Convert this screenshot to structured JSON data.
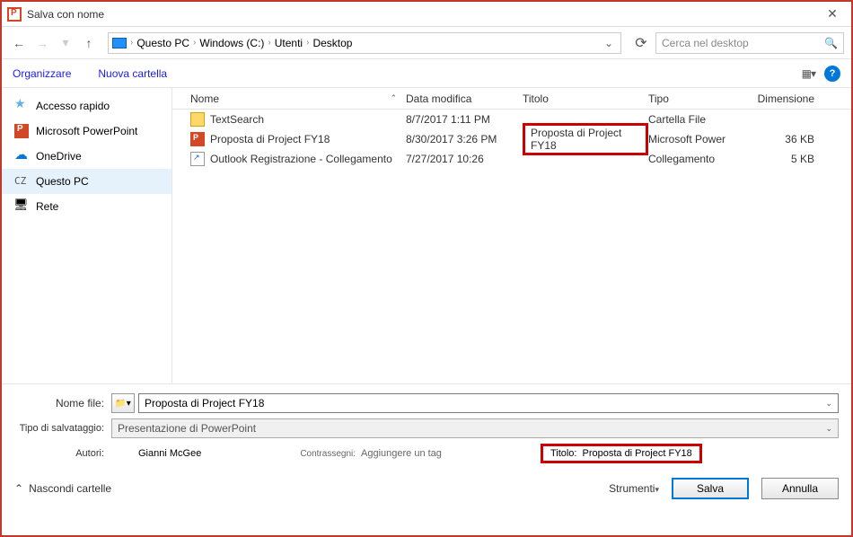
{
  "titlebar": {
    "title": "Salva con nome"
  },
  "breadcrumb": {
    "parts": [
      "Questo PC",
      "Windows (C:)",
      "Utenti",
      "Desktop"
    ]
  },
  "search": {
    "placeholder": "Cerca nel desktop"
  },
  "toolbar": {
    "organize": "Organizzare",
    "new_folder": "Nuova cartella"
  },
  "columns": {
    "name": "Nome",
    "date": "Data modifica",
    "title": "Titolo",
    "type": "Tipo",
    "size": "Dimensione"
  },
  "sidebar": {
    "items": [
      {
        "label": "Accesso rapido"
      },
      {
        "label": "Microsoft PowerPoint"
      },
      {
        "label": "OneDrive"
      },
      {
        "label": "Questo PC",
        "prefix": "CZ"
      },
      {
        "label": "Rete"
      }
    ]
  },
  "files": [
    {
      "name": "TextSearch",
      "date": "8/7/2017 1:11 PM",
      "title": "",
      "type": "Cartella File",
      "size": "",
      "icon": "folder"
    },
    {
      "name": "Proposta di Project FY18",
      "date": "8/30/2017 3:26 PM",
      "title": "Proposta di Project FY18",
      "type": "Microsoft Power",
      "size": "36 KB",
      "icon": "pp",
      "title_highlight": true
    },
    {
      "name": "Outlook Registrazione - Collegamento",
      "date": "7/27/2017  10:26",
      "title": "",
      "type": "Collegamento",
      "size": "5 KB",
      "icon": "link"
    }
  ],
  "form": {
    "filename_label": "Nome file:",
    "filename_value": "Proposta di Project FY18",
    "type_label": "Tipo di salvataggio:",
    "type_value": "Presentazione di PowerPoint",
    "authors_label": "Autori:",
    "authors_value": "Gianni McGee",
    "tags_label": "Contrassegni:",
    "tags_value": "Aggiungere un tag",
    "title_label": "Titolo:",
    "title_value": "Proposta di Project FY18"
  },
  "footer": {
    "hide_folders": "Nascondi cartelle",
    "tools": "Strumenti",
    "save": "Salva",
    "cancel": "Annulla"
  }
}
